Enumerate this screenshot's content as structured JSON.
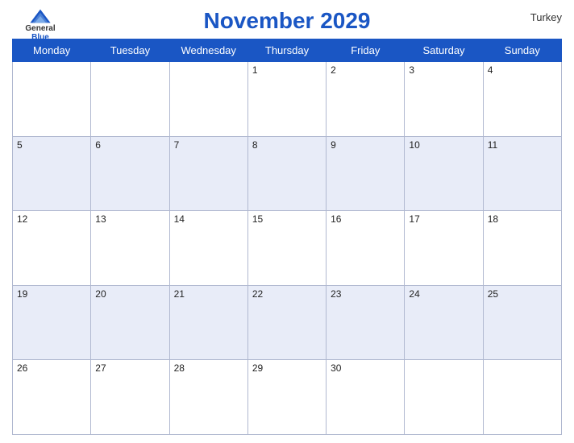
{
  "header": {
    "title": "November 2029",
    "country": "Turkey",
    "logo": {
      "general": "General",
      "blue": "Blue"
    }
  },
  "weekdays": [
    "Monday",
    "Tuesday",
    "Wednesday",
    "Thursday",
    "Friday",
    "Saturday",
    "Sunday"
  ],
  "weeks": [
    [
      "",
      "",
      "",
      "1",
      "2",
      "3",
      "4"
    ],
    [
      "5",
      "6",
      "7",
      "8",
      "9",
      "10",
      "11"
    ],
    [
      "12",
      "13",
      "14",
      "15",
      "16",
      "17",
      "18"
    ],
    [
      "19",
      "20",
      "21",
      "22",
      "23",
      "24",
      "25"
    ],
    [
      "26",
      "27",
      "28",
      "29",
      "30",
      "",
      ""
    ]
  ]
}
